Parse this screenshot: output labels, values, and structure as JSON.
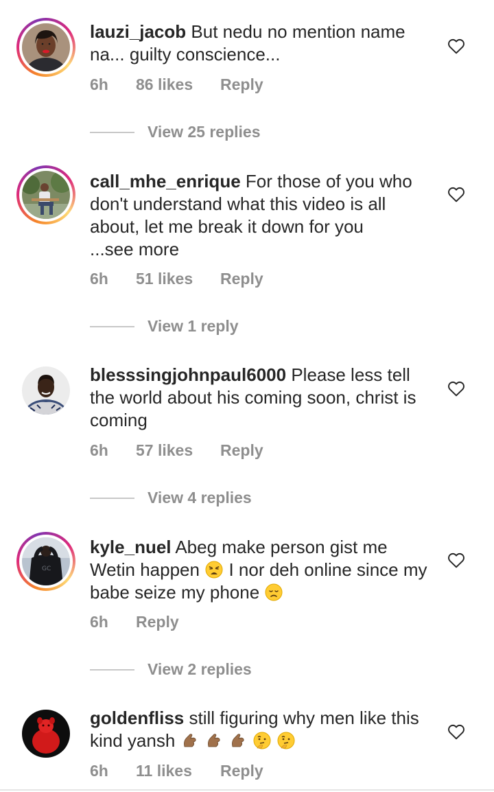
{
  "comments": [
    {
      "username": "lauzi_jacob",
      "text": "But nedu no mention name na... guilty conscience...",
      "time": "6h",
      "likes": "86 likes",
      "reply": "Reply",
      "view_replies": "View 25 replies",
      "avatar_icon": "profile-photo-woman-red-lips",
      "has_story_ring": true
    },
    {
      "username": "call_mhe_enrique",
      "text": "For those of you who don't understand what this video is all about, let me break it down for you",
      "see_more": "...see more",
      "time": "6h",
      "likes": "51 likes",
      "reply": "Reply",
      "view_replies": "View 1 reply",
      "avatar_icon": "profile-photo-man-seated-garden",
      "has_story_ring": true
    },
    {
      "username": "blesssingjohnpaul6000",
      "text": "Please  less tell the world about his coming soon, christ is coming",
      "time": "6h",
      "likes": "57 likes",
      "reply": "Reply",
      "view_replies": "View 4 replies",
      "avatar_icon": "profile-photo-woman-smiling",
      "has_story_ring": false
    },
    {
      "username": "kyle_nuel",
      "text_part1": "Abeg make person gist me Wetin happen",
      "emoji1": "weary-face-emoji",
      "text_part2": "I nor deh online since my babe seize my phone",
      "emoji2": "disappointed-face-emoji",
      "time": "6h",
      "reply": "Reply",
      "view_replies": "View 2 replies",
      "avatar_icon": "profile-photo-man-black-jacket",
      "has_story_ring": true
    },
    {
      "username": "goldenfliss",
      "text": "still figuring why men like this kind yansh",
      "emojis": [
        "pinching-hand-emoji",
        "pinching-hand-emoji",
        "pinching-hand-emoji",
        "thinking-face-emoji",
        "thinking-face-emoji"
      ],
      "time": "6h",
      "likes": "11 likes",
      "reply": "Reply",
      "avatar_icon": "profile-photo-red-figure",
      "has_story_ring": false
    }
  ],
  "colors": {
    "text": "#262626",
    "secondary": "#8e8e8e",
    "divider": "#c7c7c7"
  }
}
